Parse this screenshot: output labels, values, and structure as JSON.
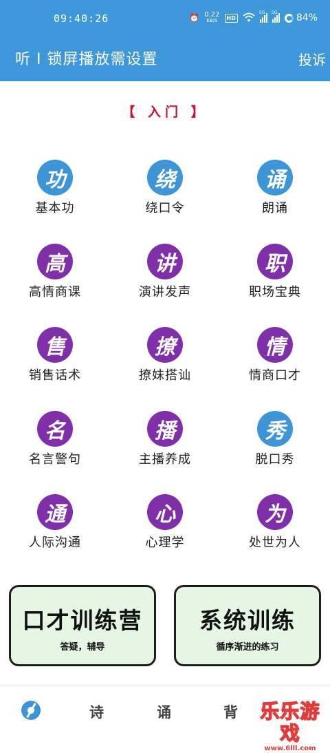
{
  "status_bar": {
    "time": "09:40:26",
    "net_speed": "0.22",
    "net_speed_unit": "KB/S",
    "hd": "HD",
    "signal_1": "5G",
    "signal_2": "5G",
    "battery": "84%",
    "color": "#3c98d9"
  },
  "app_bar": {
    "title": "听 I 锁屏播放需设置",
    "action": "投诉",
    "color": "#3c98d9"
  },
  "section_title": "【 入门 】",
  "grid": [
    {
      "glyph": "功",
      "label": "基本功",
      "color": "blue"
    },
    {
      "glyph": "绕",
      "label": "绕口令",
      "color": "blue"
    },
    {
      "glyph": "诵",
      "label": "朗诵",
      "color": "blue"
    },
    {
      "glyph": "高",
      "label": "高情商课",
      "color": "purple"
    },
    {
      "glyph": "讲",
      "label": "演讲发声",
      "color": "purple"
    },
    {
      "glyph": "职",
      "label": "职场宝典",
      "color": "purple"
    },
    {
      "glyph": "售",
      "label": "销售话术",
      "color": "purple"
    },
    {
      "glyph": "撩",
      "label": "撩妹搭讪",
      "color": "purple"
    },
    {
      "glyph": "情",
      "label": "情商口才",
      "color": "purple"
    },
    {
      "glyph": "名",
      "label": "名言警句",
      "color": "purple"
    },
    {
      "glyph": "播",
      "label": "主播养成",
      "color": "purple"
    },
    {
      "glyph": "秀",
      "label": "脱口秀",
      "color": "blue"
    },
    {
      "glyph": "通",
      "label": "人际沟通",
      "color": "purple"
    },
    {
      "glyph": "心",
      "label": "心理学",
      "color": "purple"
    },
    {
      "glyph": "为",
      "label": "处世为人",
      "color": "purple"
    }
  ],
  "cards": [
    {
      "title": "口才训练营",
      "subtitle": "答疑，辅导"
    },
    {
      "title": "系统训练",
      "subtitle": "循序渐进的练习"
    }
  ],
  "tabs": {
    "home_icon": "aperture-icon",
    "shi": "诗",
    "song": "诵",
    "bei": "背"
  },
  "watermark": {
    "text": "乐乐游戏",
    "url": "www.6lll.com"
  }
}
